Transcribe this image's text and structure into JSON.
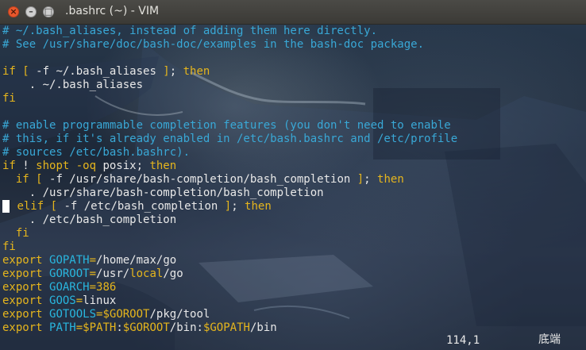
{
  "window": {
    "title": ".bashrc (~) - VIM"
  },
  "buttons": {
    "close": "×",
    "minimize": "–",
    "maximize": "□"
  },
  "lines": [
    {
      "segs": [
        {
          "t": "# ~/.bash_aliases, instead of adding them here directly.",
          "c": "c"
        }
      ]
    },
    {
      "segs": [
        {
          "t": "# See /usr/share/doc/bash-doc/examples in the bash-doc package.",
          "c": "c"
        }
      ]
    },
    {
      "segs": []
    },
    {
      "segs": [
        {
          "t": "if",
          "c": "k"
        },
        {
          "t": " [ ",
          "c": "k"
        },
        {
          "t": "-f ~/.bash_aliases",
          "c": "w"
        },
        {
          "t": " ]",
          "c": "k"
        },
        {
          "t": "; ",
          "c": "w"
        },
        {
          "t": "then",
          "c": "k"
        }
      ]
    },
    {
      "segs": [
        {
          "t": "    . ~/.bash_aliases",
          "c": "w"
        }
      ]
    },
    {
      "segs": [
        {
          "t": "fi",
          "c": "k"
        }
      ]
    },
    {
      "segs": []
    },
    {
      "segs": [
        {
          "t": "# enable programmable completion features (you don't need to enable",
          "c": "c"
        }
      ]
    },
    {
      "segs": [
        {
          "t": "# this, if it's already enabled in /etc/bash.bashrc and /etc/profile",
          "c": "c"
        }
      ]
    },
    {
      "segs": [
        {
          "t": "# sources /etc/bash.bashrc).",
          "c": "c"
        }
      ]
    },
    {
      "segs": [
        {
          "t": "if",
          "c": "k"
        },
        {
          "t": " ! ",
          "c": "w"
        },
        {
          "t": "shopt -oq",
          "c": "k"
        },
        {
          "t": " posix",
          "c": "w"
        },
        {
          "t": "; ",
          "c": "w"
        },
        {
          "t": "then",
          "c": "k"
        }
      ]
    },
    {
      "segs": [
        {
          "t": "  ",
          "c": "w"
        },
        {
          "t": "if",
          "c": "k"
        },
        {
          "t": " [ ",
          "c": "k"
        },
        {
          "t": "-f /usr/share/bash-completion/bash_completion",
          "c": "w"
        },
        {
          "t": " ]",
          "c": "k"
        },
        {
          "t": "; ",
          "c": "w"
        },
        {
          "t": "then",
          "c": "k"
        }
      ]
    },
    {
      "segs": [
        {
          "t": "    . /usr/share/bash-completion/bash_completion",
          "c": "w"
        }
      ]
    },
    {
      "cursor": true,
      "segs": [
        {
          "t": " ",
          "c": "w"
        },
        {
          "t": "elif",
          "c": "k"
        },
        {
          "t": " [ ",
          "c": "k"
        },
        {
          "t": "-f /etc/bash_completion",
          "c": "w"
        },
        {
          "t": " ]",
          "c": "k"
        },
        {
          "t": "; ",
          "c": "w"
        },
        {
          "t": "then",
          "c": "k"
        }
      ]
    },
    {
      "segs": [
        {
          "t": "    . /etc/bash_completion",
          "c": "w"
        }
      ]
    },
    {
      "segs": [
        {
          "t": "  fi",
          "c": "k"
        }
      ]
    },
    {
      "segs": [
        {
          "t": "fi",
          "c": "k"
        }
      ]
    },
    {
      "segs": [
        {
          "t": "export ",
          "c": "k"
        },
        {
          "t": "GOPATH",
          "c": "p"
        },
        {
          "t": "=",
          "c": "k"
        },
        {
          "t": "/home/max/go",
          "c": "w"
        }
      ]
    },
    {
      "segs": [
        {
          "t": "export ",
          "c": "k"
        },
        {
          "t": "GOROOT",
          "c": "p"
        },
        {
          "t": "=",
          "c": "k"
        },
        {
          "t": "/usr/",
          "c": "w"
        },
        {
          "t": "local",
          "c": "k"
        },
        {
          "t": "/go",
          "c": "w"
        }
      ]
    },
    {
      "segs": [
        {
          "t": "export ",
          "c": "k"
        },
        {
          "t": "GOARCH",
          "c": "p"
        },
        {
          "t": "=",
          "c": "k"
        },
        {
          "t": "386",
          "c": "k"
        }
      ]
    },
    {
      "segs": [
        {
          "t": "export ",
          "c": "k"
        },
        {
          "t": "GOOS",
          "c": "p"
        },
        {
          "t": "=",
          "c": "k"
        },
        {
          "t": "linux",
          "c": "w"
        }
      ]
    },
    {
      "segs": [
        {
          "t": "export ",
          "c": "k"
        },
        {
          "t": "GOTOOLS",
          "c": "p"
        },
        {
          "t": "=",
          "c": "k"
        },
        {
          "t": "$GOROOT",
          "c": "k"
        },
        {
          "t": "/pkg/tool",
          "c": "w"
        }
      ]
    },
    {
      "segs": [
        {
          "t": "export ",
          "c": "k"
        },
        {
          "t": "PATH",
          "c": "p"
        },
        {
          "t": "=",
          "c": "k"
        },
        {
          "t": "$PATH",
          "c": "k"
        },
        {
          "t": ":",
          "c": "w"
        },
        {
          "t": "$GOROOT",
          "c": "k"
        },
        {
          "t": "/bin:",
          "c": "w"
        },
        {
          "t": "$GOPATH",
          "c": "k"
        },
        {
          "t": "/bin",
          "c": "w"
        }
      ]
    }
  ],
  "status": {
    "position": "114,1",
    "scroll": "底端"
  },
  "colors": {
    "comment": "#39a8d6",
    "keyword": "#e5b51d",
    "identifier": "#29b6de",
    "text": "#e8e8e8",
    "close_button": "#e9572c"
  }
}
